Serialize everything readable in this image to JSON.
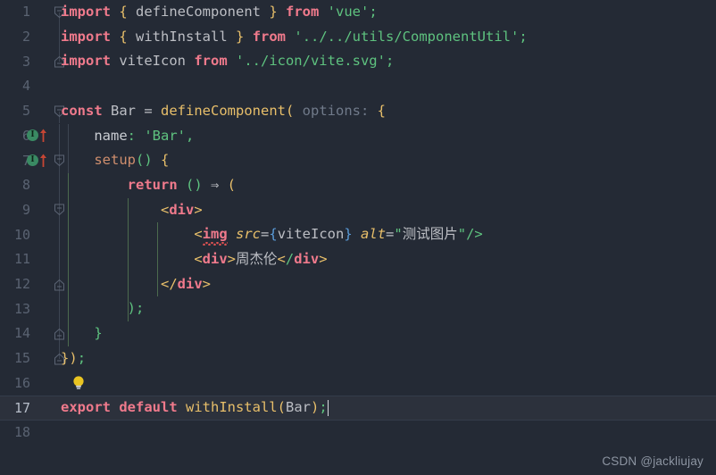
{
  "editor": {
    "theme": "jetbrains-dark",
    "background": "#242a35",
    "active_line_background": "#2c313c",
    "line_number_color": "#5a6372",
    "font_size_px": 15.5,
    "line_height_px": 27.7,
    "total_lines": 18,
    "active_line": 17,
    "caret_line": 17
  },
  "colors": {
    "keyword": "#f07a8c",
    "string": "#5ec27f",
    "brace": "#e8bf6a",
    "identifier": "#bcbec4",
    "function": "#e8bf6a",
    "tag": "#f07a8c",
    "attribute": "#e8bf6a",
    "inlay_hint": "#707a8a",
    "gutter_marker_circle": "#3a8a63",
    "gutter_marker_arrow": "#c74634",
    "bulb": "#e9c421",
    "error_squiggle": "#e05252",
    "fold_line": "#3d4552",
    "indent_guide_active": "#4c6a4e"
  },
  "gutter": {
    "markers": [
      {
        "line": 6,
        "circle_label": "I",
        "name": "implemented-marker"
      },
      {
        "line": 7,
        "circle_label": "I",
        "name": "implemented-marker"
      }
    ],
    "bulb_line": 16
  },
  "lines": [
    {
      "n": "1",
      "fold": "start"
    },
    {
      "n": "2",
      "fold": "mid"
    },
    {
      "n": "3",
      "fold": "end"
    },
    {
      "n": "4",
      "fold": "none"
    },
    {
      "n": "5",
      "fold": "start"
    },
    {
      "n": "6",
      "fold": "mid"
    },
    {
      "n": "7",
      "fold": "start"
    },
    {
      "n": "8",
      "fold": "mid"
    },
    {
      "n": "9",
      "fold": "start"
    },
    {
      "n": "10",
      "fold": "mid"
    },
    {
      "n": "11",
      "fold": "mid"
    },
    {
      "n": "12",
      "fold": "end"
    },
    {
      "n": "13",
      "fold": "mid"
    },
    {
      "n": "14",
      "fold": "end"
    },
    {
      "n": "15",
      "fold": "end"
    },
    {
      "n": "16",
      "fold": "none"
    },
    {
      "n": "17",
      "fold": "none"
    },
    {
      "n": "18",
      "fold": "none"
    }
  ],
  "code": {
    "l1": {
      "kw_import": "import",
      "brace_open": "{",
      "name": " defineComponent ",
      "brace_close": "}",
      "kw_from": " from ",
      "module": "'vue';"
    },
    "l2": {
      "kw_import": "import",
      "brace_open": "{",
      "name": " withInstall ",
      "brace_close": "}",
      "kw_from": " from ",
      "module": "'../../utils/ComponentUtil';"
    },
    "l3": {
      "kw_import": "import",
      "name": " viteIcon ",
      "kw_from": "from",
      "module": " '../icon/vite.svg';"
    },
    "l5": {
      "kw_const": "const",
      "name": " Bar ",
      "eq": "= ",
      "fn": "defineComponent",
      "paren": "(",
      "hint": " options: ",
      "brace": "{"
    },
    "l6": {
      "prop": "name",
      "colon": ":",
      "value": " 'Bar'",
      "comma": ","
    },
    "l7": {
      "fn": "setup",
      "parens": "()",
      "brace": " {"
    },
    "l8": {
      "kw_return": "return",
      "parens": " ()",
      "arrow": " ⇒ ",
      "paren": "("
    },
    "l9": {
      "lt": "<",
      "tag": "div",
      "gt": ">"
    },
    "l10": {
      "lt": "<",
      "tag": "img",
      "attr_src": "src",
      "eq1": "=",
      "bopen": "{",
      "expr": "viteIcon",
      "bclose": "}",
      "attr_alt": "alt",
      "eq2": "=",
      "quote_open": "\"",
      "alt_value": "测试图片",
      "quote_close": "\"",
      "selfclose": "/>"
    },
    "l11": {
      "lt1": "<",
      "tag1": "div",
      "gt1": ">",
      "text": "周杰伦",
      "lt2": "<",
      "slash": "/",
      "tag2": "div",
      "gt2": ">"
    },
    "l12": {
      "lt": "<",
      "slash": "/",
      "tag": "div",
      "gt": ">"
    },
    "l13": {
      "text": ");"
    },
    "l14": {
      "text": "}"
    },
    "l15": {
      "brace": "}",
      "paren": ")",
      "semi": ";"
    },
    "l17": {
      "kw_export": "export",
      "kw_default": " default",
      "fn": " withInstall",
      "paren_open": "(",
      "arg": "Bar",
      "paren_close": ")",
      "semi": ";"
    }
  },
  "watermark": {
    "text": "CSDN @jackliujay"
  }
}
